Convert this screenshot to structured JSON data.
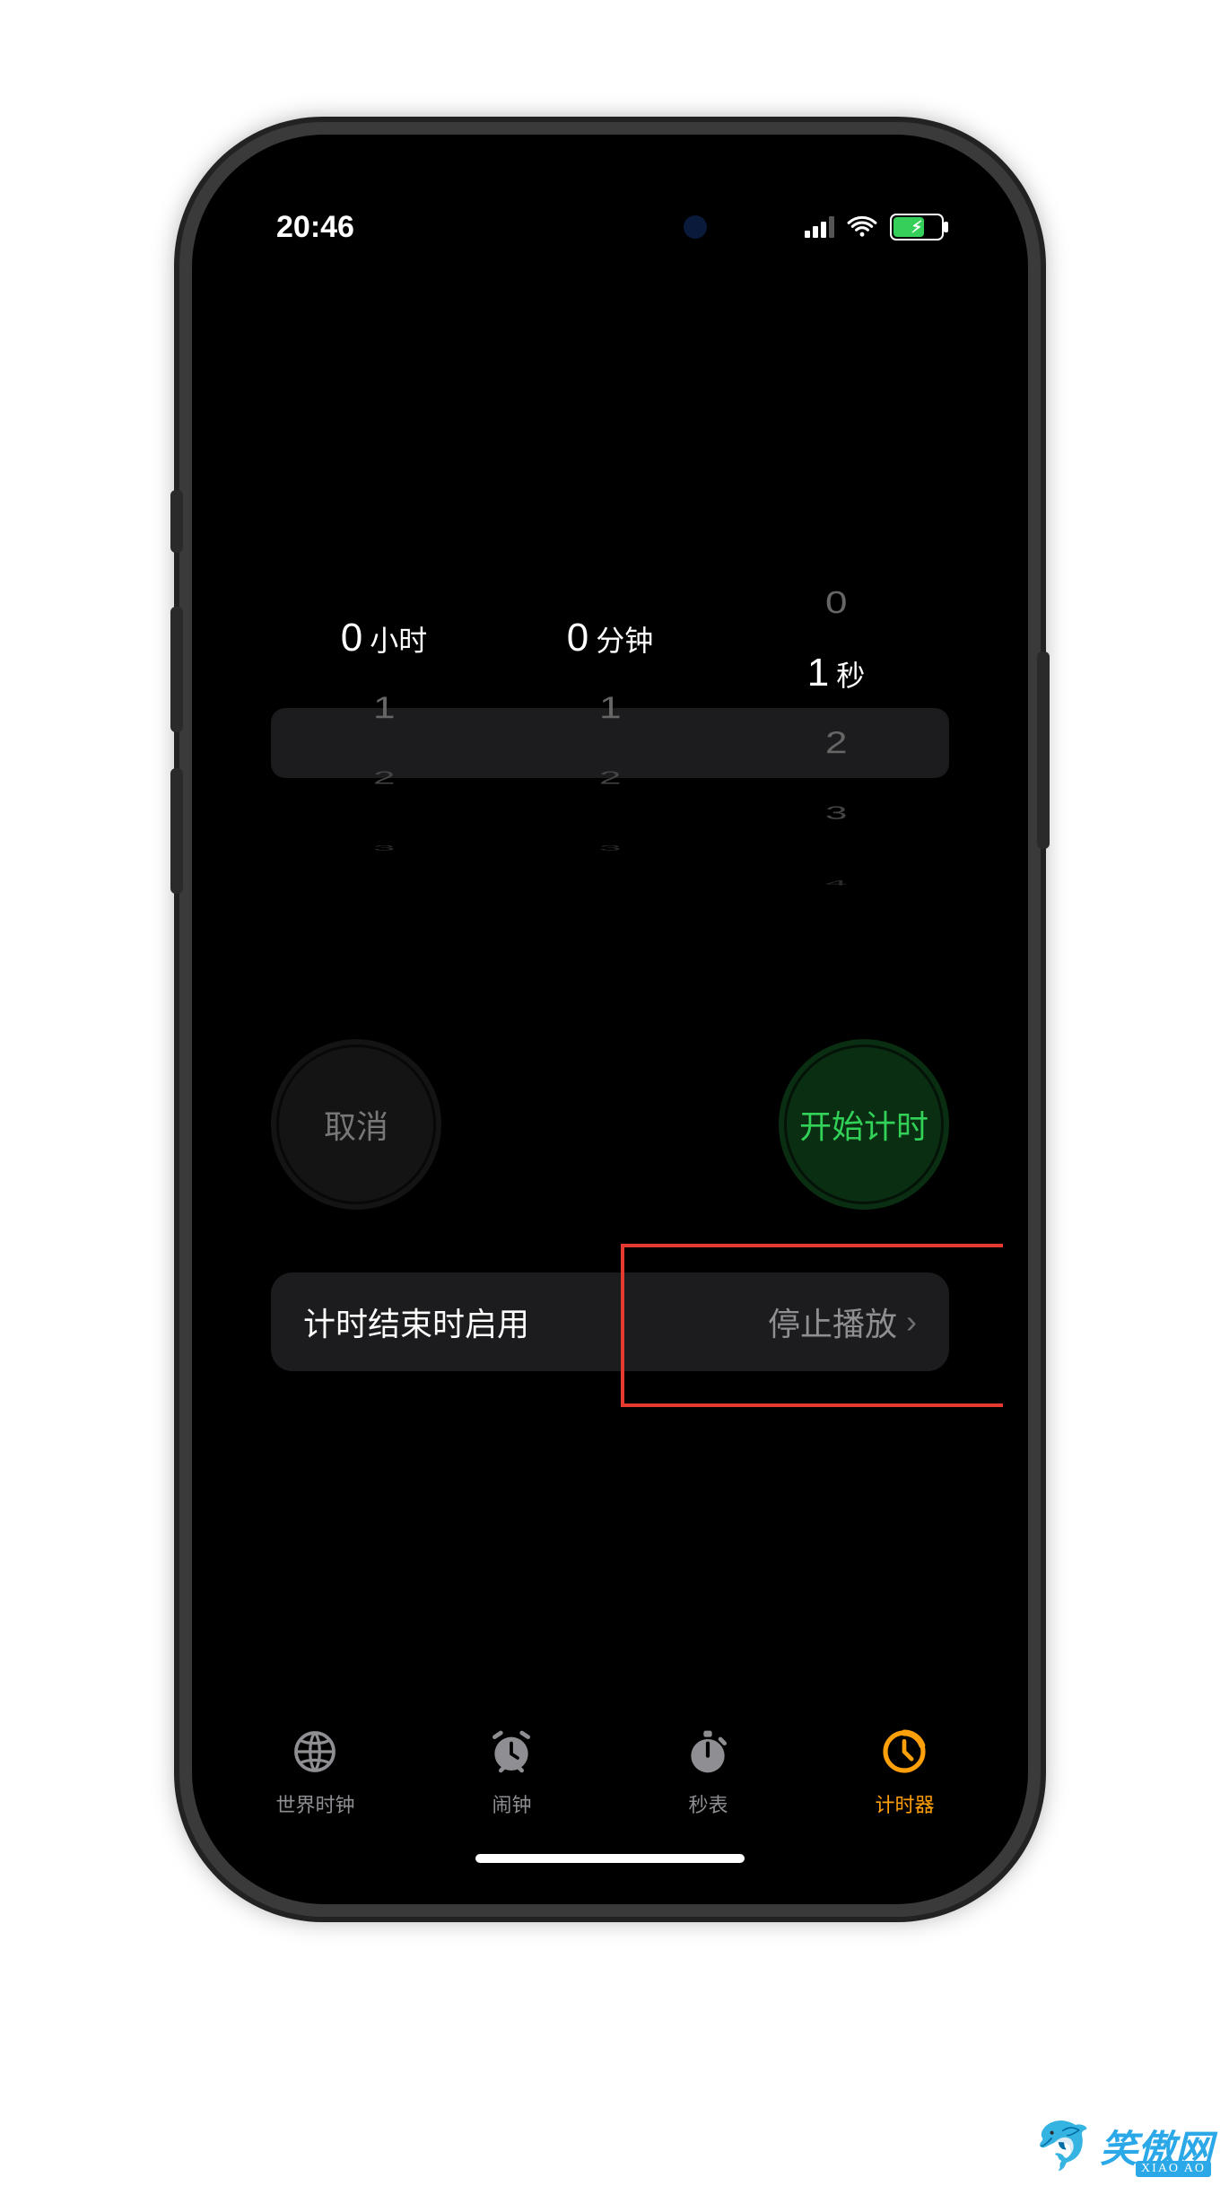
{
  "status": {
    "time": "20:46",
    "signal_bars": 3,
    "wifi": true,
    "battery_charging": true,
    "battery_percent": 60
  },
  "picker": {
    "hours": {
      "selected": "0",
      "unit": "小时",
      "next": [
        "1",
        "2",
        "3"
      ]
    },
    "minutes": {
      "selected": "0",
      "unit": "分钟",
      "next": [
        "1",
        "2",
        "3"
      ]
    },
    "seconds": {
      "prev": [
        "0"
      ],
      "selected": "1",
      "unit": "秒",
      "next": [
        "2",
        "3",
        "4"
      ]
    }
  },
  "buttons": {
    "cancel": "取消",
    "start": "开始计时"
  },
  "sound_row": {
    "label": "计时结束时启用",
    "value": "停止播放"
  },
  "tabs": {
    "world_clock": "世界时钟",
    "alarm": "闹钟",
    "stopwatch": "秒表",
    "timer": "计时器"
  },
  "watermark": {
    "text": "笑傲网",
    "sub": "XIAO AO"
  },
  "colors": {
    "accent_orange": "#ff9f0a",
    "start_green_text": "#32d158",
    "start_green_bg": "#0a2e12",
    "highlight_red": "#e43a2f",
    "cell_bg": "#1c1c1e",
    "muted_text": "#8e8e93"
  }
}
